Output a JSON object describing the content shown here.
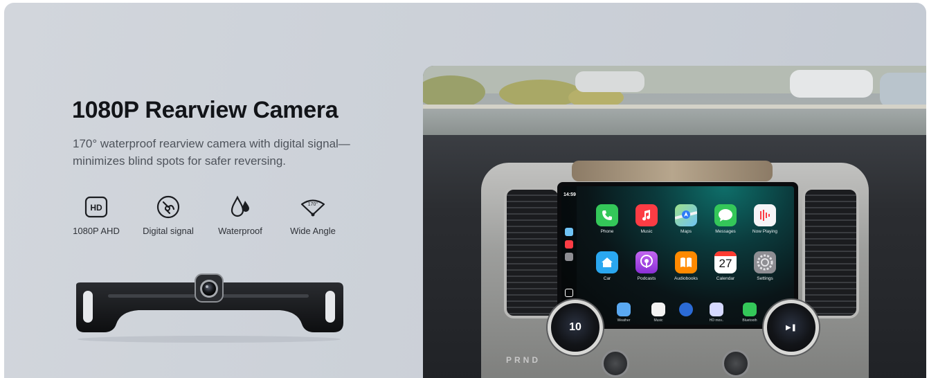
{
  "hero": {
    "title": "1080P Rearview Camera",
    "description": "170° waterproof rearview camera with digital signal—minimizes blind spots for safer reversing."
  },
  "features": [
    {
      "icon": "hd-icon",
      "label": "1080P AHD"
    },
    {
      "icon": "digital-signal-icon",
      "label": "Digital signal"
    },
    {
      "icon": "water-drop-icon",
      "label": "Waterproof"
    },
    {
      "icon": "wide-angle-icon",
      "label": "Wide Angle",
      "badge": "170°"
    }
  ],
  "carplay": {
    "time": "14:59",
    "apps": [
      {
        "name": "Phone",
        "color": "#34c759"
      },
      {
        "name": "Music",
        "color": "#fc3c44"
      },
      {
        "name": "Maps",
        "color": "#6fc3f5"
      },
      {
        "name": "Messages",
        "color": "#34c759"
      },
      {
        "name": "Now Playing",
        "color": "#f5f5f7"
      },
      {
        "name": "Car",
        "color": "#2aa7f0"
      },
      {
        "name": "Podcasts",
        "color": "#a24be0"
      },
      {
        "name": "Audiobooks",
        "color": "#ff8a00"
      },
      {
        "name": "Calendar",
        "color": "#ffffff"
      },
      {
        "name": "Settings",
        "color": "#8e8e93"
      }
    ],
    "calendar_day": "27",
    "dock": [
      {
        "name": "Weather",
        "color": "#5aa9f2"
      },
      {
        "name": "Music",
        "color": "#f3f3f3"
      },
      {
        "name": "",
        "color": "#2b6bd6"
      },
      {
        "name": "HD mov..",
        "color": "#d6d9ff"
      },
      {
        "name": "Bluetooth",
        "color": "#34c759"
      }
    ],
    "left_knob_value": "10",
    "gear_labels": "PRND"
  }
}
